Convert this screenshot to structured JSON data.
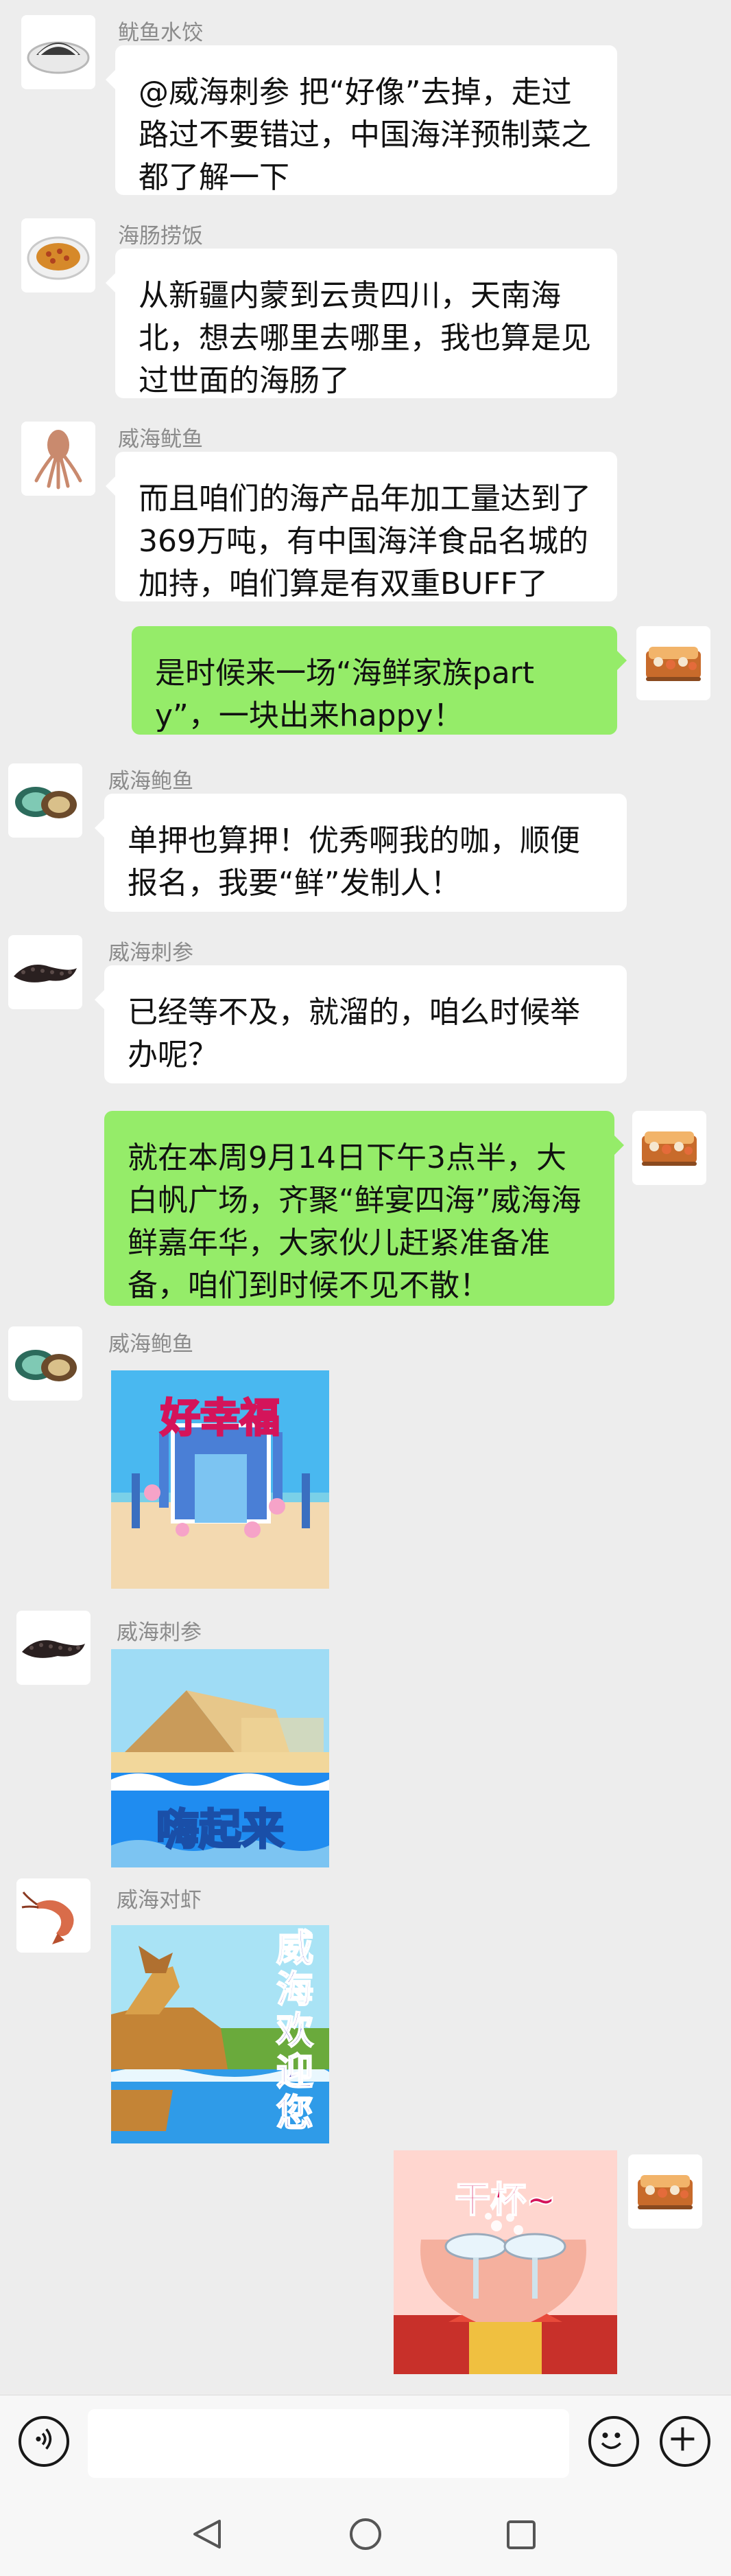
{
  "messages": [
    {
      "sender": "鱿鱼水饺",
      "text": "@威海刺参 把“好像”去掉，走过路过不要错过，中国海洋预制菜之都了解一下",
      "avatar_icon": "dumpling-plate-icon"
    },
    {
      "sender": "海肠捞饭",
      "text": "从新疆内蒙到云贵四川，天南海北，想去哪里去哪里，我也算是见过世面的海肠了",
      "avatar_icon": "sea-worm-rice-plate-icon"
    },
    {
      "sender": "威海鱿鱼",
      "text": "而且咱们的海产品年加工量达到了369万吨，有中国海洋食品名城的加持，咱们算是有双重BUFF了",
      "avatar_icon": "squid-icon"
    },
    {
      "sender": "",
      "text": "是时候来一场“海鲜家族party”，一块出来happy！",
      "avatar_icon": "seafood-tray-icon"
    },
    {
      "sender": "威海鲍鱼",
      "text": "单押也算押！优秀啊我的咖，顺便报名，我要“鲜”发制人！",
      "avatar_icon": "abalone-icon"
    },
    {
      "sender": "威海刺参",
      "text": "已经等不及，就溜的，咱么时候举办呢？",
      "avatar_icon": "sea-cucumber-icon"
    },
    {
      "sender": "",
      "text": "就在本周9月14日下午3点半，大白帆广场，齐聚“鲜宴四海”威海海鲜嘉年华，大家伙儿赶紧准备准备，咱们到时候不见不散！",
      "avatar_icon": "seafood-tray-icon"
    },
    {
      "sender": "威海鲍鱼",
      "sticker_text": "好幸福",
      "avatar_icon": "abalone-icon"
    },
    {
      "sender": "威海刺参",
      "sticker_text": "嗨起来",
      "avatar_icon": "sea-cucumber-icon"
    },
    {
      "sender": "威海对虾",
      "sticker_text": "威海欢迎您",
      "sticker_chars": [
        "威",
        "海",
        "欢",
        "迎",
        "您"
      ],
      "avatar_icon": "shrimp-icon"
    },
    {
      "sender": "",
      "sticker_text": "干杯~",
      "avatar_icon": "seafood-tray-icon"
    }
  ],
  "input_bar": {
    "voice_icon": "voice-icon",
    "emoji_icon": "emoji-icon",
    "plus_icon": "plus-icon",
    "input_value": ""
  },
  "nav_bar": {
    "back_icon": "back-icon",
    "home_icon": "home-icon",
    "recents_icon": "recents-icon"
  },
  "colors": {
    "background": "#ededed",
    "incoming_bubble": "#ffffff",
    "outgoing_bubble": "#95ec69",
    "sender_name": "#8b8b8b",
    "sticker_blue": "#1f8cf0",
    "sticker_yellow": "#ffd21a"
  }
}
